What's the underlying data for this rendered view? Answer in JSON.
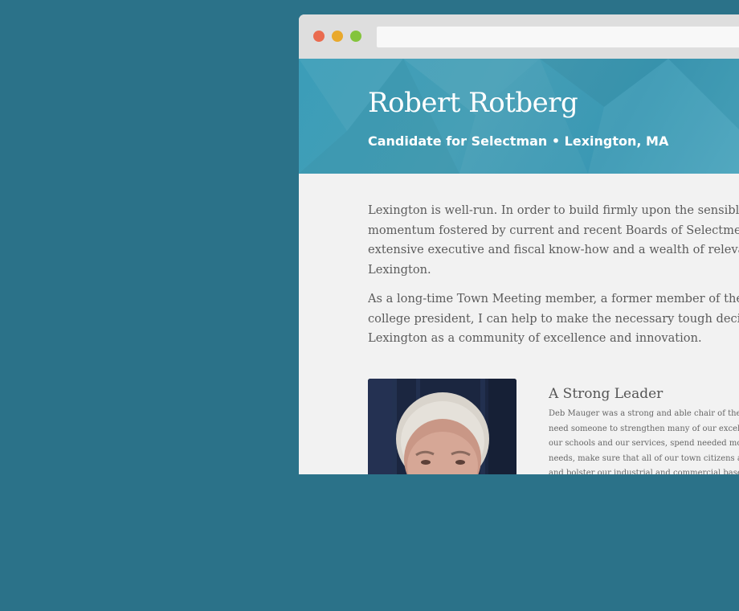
{
  "window": {
    "controls": [
      "close",
      "minimize",
      "maximize"
    ],
    "colors": {
      "close": "#ea6b4f",
      "minimize": "#e9a92c",
      "maximize": "#84c43c"
    },
    "address": ""
  },
  "hero": {
    "title": "Robert Rotberg",
    "subtitle": "Candidate for Selectman • Lexington, MA"
  },
  "intro": {
    "paragraph1": [
      "Lexington is well-run. In order to build firmly upon the sensible and res",
      "momentum fostered by current and recent Boards of Selectmen, the to",
      "extensive executive and fiscal know-how and a wealth of relevant expe",
      "Lexington."
    ],
    "paragraph2": [
      "As a long-time Town Meeting member, a former member of the School",
      "college president, I can help to make the necessary tough decisions tha",
      "Lexington as a community of excellence and innovation."
    ]
  },
  "section": {
    "photo_alt": "Portrait of Robert Rotberg",
    "title": "A Strong Leader",
    "body": [
      "Deb Mauger was a strong and able chair of the Bo",
      "need someone to strengthen many of our excelle",
      "our schools and our services, spend needed mon",
      "needs, make sure that all of our town citizens are",
      "and bolster our industrial and commercial base, a"
    ]
  },
  "colors": {
    "background": "#2b7289",
    "hero": "#3f9fb8",
    "page": "#f2f2f2",
    "titlebar": "#dedede"
  }
}
